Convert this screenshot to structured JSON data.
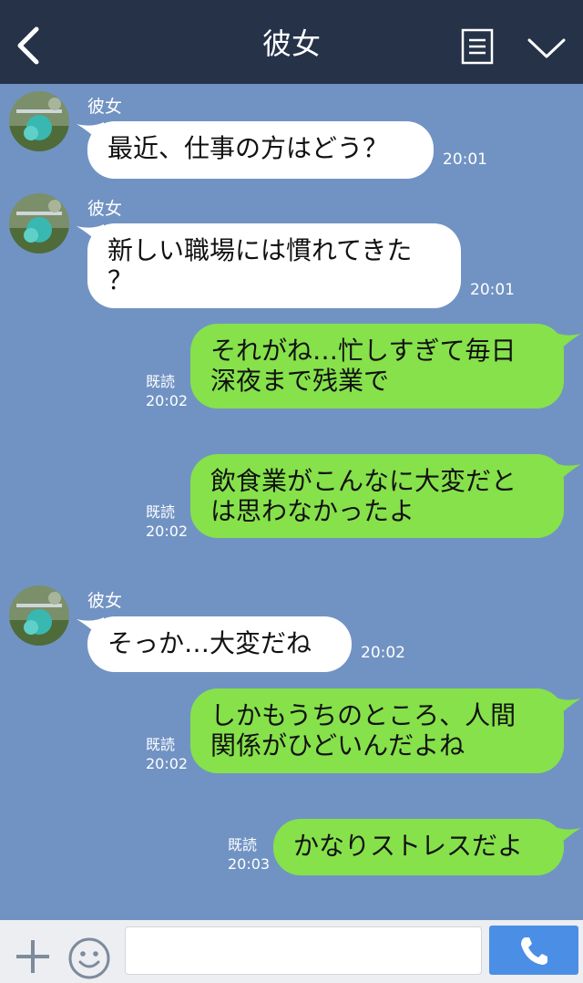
{
  "header": {
    "title": "彼女",
    "back_icon": "chevron-left-icon",
    "menu_icon": "note-icon",
    "collapse_icon": "chevron-down-icon",
    "background": "#253248"
  },
  "chat": {
    "background": "#7193c3",
    "messages": [
      {
        "from": "彼女",
        "lines": [
          "最近、仕事の方はどう？"
        ],
        "time": "20:01"
      },
      {
        "from": "彼女",
        "lines": [
          "新しい職場には慣れてきた",
          "？"
        ],
        "time": "20:01"
      },
      {
        "from": "me",
        "lines": [
          "それがね…忙しすぎて毎日",
          "深夜まで残業で"
        ],
        "read": "既読",
        "time": "20:02"
      },
      {
        "from": "me",
        "lines": [
          "飲食業がこんなに大変だと",
          "は思わなかったよ"
        ],
        "read": "既読",
        "time": "20:02"
      },
      {
        "from": "彼女",
        "lines": [
          "そっか…大変だね"
        ],
        "time": "20:02"
      },
      {
        "from": "me",
        "lines": [
          "しかもうちのところ、人間",
          "関係がひどいんだよね"
        ],
        "read": "既読",
        "time": "20:02"
      },
      {
        "from": "me",
        "lines": [
          "かなりストレスだよ"
        ],
        "read": "既読",
        "time": "20:03"
      }
    ],
    "colors": {
      "incoming_bubble": "#ffffff",
      "outgoing_bubble": "#86e14b"
    }
  },
  "input_bar": {
    "plus_icon": "plus-icon",
    "emoji_icon": "smiley-icon",
    "message_value": "",
    "call_icon": "phone-icon",
    "call_color": "#4b8ee6"
  }
}
